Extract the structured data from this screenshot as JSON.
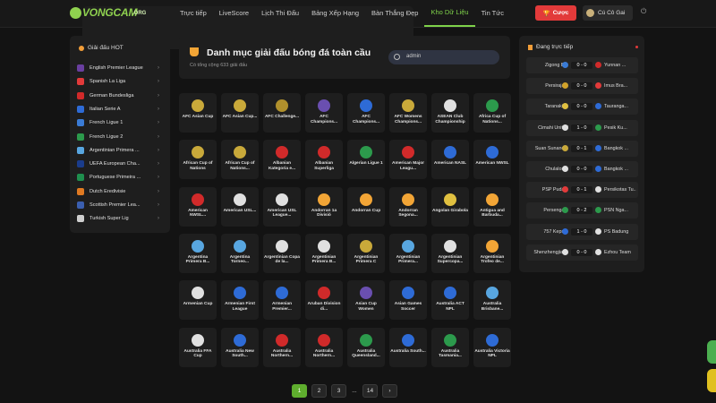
{
  "header": {
    "logo_text": "VONGCAM",
    "logo_tld": ".ORG",
    "nav": [
      "Trực tiếp",
      "LiveScore",
      "Lịch Thi Đấu",
      "Bảng Xếp Hạng",
      "Bàn Thắng Đẹp",
      "Kho Dữ Liệu",
      "Tin Tức"
    ],
    "active_nav": "Kho Dữ Liệu",
    "bet_label": "Cược",
    "user_name": "Cú Cô Gai",
    "accent": "#7fd24a"
  },
  "sidebar": {
    "title": "Giải đấu HOT",
    "leagues": [
      {
        "label": "English Premier League",
        "color": "#6a3fa0"
      },
      {
        "label": "Spanish La Liga",
        "color": "#e23a3a"
      },
      {
        "label": "German Bundesliga",
        "color": "#d12a2a"
      },
      {
        "label": "Italian Serie A",
        "color": "#2e6bd6"
      },
      {
        "label": "French Ligue 1",
        "color": "#3a7bd5"
      },
      {
        "label": "French Ligue 2",
        "color": "#2c9a4c"
      },
      {
        "label": "Argentinian Primera ...",
        "color": "#58a6e0"
      },
      {
        "label": "UEFA European Cha...",
        "color": "#1a3c8c"
      },
      {
        "label": "Portuguese Primeira ...",
        "color": "#1f8f4e"
      },
      {
        "label": "Dutch Eredivisie",
        "color": "#e07a22"
      },
      {
        "label": "Scottish Premier Lea...",
        "color": "#3b5fb0"
      },
      {
        "label": "Turkish Super Lig",
        "color": "#cfcfcf"
      }
    ]
  },
  "main": {
    "title": "Danh mục giải đấu bóng đá toàn cầu",
    "subtitle": "Có tổng cộng 633 giải đấu",
    "search_value": "admin",
    "cards": [
      {
        "name": "AFC Asian Cup",
        "color": "#c9a93a"
      },
      {
        "name": "AFC Asian Cup...",
        "color": "#c9a93a"
      },
      {
        "name": "AFC Challenge...",
        "color": "#b0902c"
      },
      {
        "name": "AFC Champions...",
        "color": "#6a4fb0"
      },
      {
        "name": "AFC Champions...",
        "color": "#2e6bd6"
      },
      {
        "name": "AFC Womens Champions...",
        "color": "#c9a93a"
      },
      {
        "name": "ASEAN Club Championship",
        "color": "#e0e0e0"
      },
      {
        "name": "Africa Cup of Nations...",
        "color": "#2c9a4c"
      },
      {
        "name": "African Cup of Nations",
        "color": "#c9a93a"
      },
      {
        "name": "African Cup of Nations...",
        "color": "#c9a93a"
      },
      {
        "name": "Albanian Kategoria e...",
        "color": "#d12a2a"
      },
      {
        "name": "Albanian Superliga",
        "color": "#d12a2a"
      },
      {
        "name": "Algerian Ligue 1",
        "color": "#2c9a4c"
      },
      {
        "name": "American Major Leagu...",
        "color": "#d12a2a"
      },
      {
        "name": "American NASL",
        "color": "#2e6bd6"
      },
      {
        "name": "American NWSL",
        "color": "#2e6bd6"
      },
      {
        "name": "American NWSL...",
        "color": "#d12a2a"
      },
      {
        "name": "American USL...",
        "color": "#e0e0e0"
      },
      {
        "name": "American USL League...",
        "color": "#e0e0e0"
      },
      {
        "name": "Andorran 1a Divisió",
        "color": "#f2a536"
      },
      {
        "name": "Andorran Cup",
        "color": "#f2a536"
      },
      {
        "name": "Andorran Segona...",
        "color": "#f2a536"
      },
      {
        "name": "Angolan Girabola",
        "color": "#e0c040"
      },
      {
        "name": "Antigua and Barbuda...",
        "color": "#f2a536"
      },
      {
        "name": "Argentina Primera B...",
        "color": "#58a6e0"
      },
      {
        "name": "Argentina Torneo...",
        "color": "#58a6e0"
      },
      {
        "name": "Argentinian Copa de la...",
        "color": "#e0e0e0"
      },
      {
        "name": "Argentinian Primera B...",
        "color": "#e0e0e0"
      },
      {
        "name": "Argentinian Primera C",
        "color": "#c9a93a"
      },
      {
        "name": "Argentinian Primera...",
        "color": "#58a6e0"
      },
      {
        "name": "Argentinian Supercopa...",
        "color": "#e0e0e0"
      },
      {
        "name": "Argentinian Trofeo de...",
        "color": "#f2a536"
      },
      {
        "name": "Armenian Cup",
        "color": "#e0e0e0"
      },
      {
        "name": "Armenian First League",
        "color": "#2e6bd6"
      },
      {
        "name": "Armenian Premier...",
        "color": "#2e6bd6"
      },
      {
        "name": "Aruban Division di...",
        "color": "#d12a2a"
      },
      {
        "name": "Asian Cup Women",
        "color": "#6a4fb0"
      },
      {
        "name": "Asian Games Soccer",
        "color": "#2e6bd6"
      },
      {
        "name": "Australia ACT NPL",
        "color": "#2e6bd6"
      },
      {
        "name": "Australia Brisbane...",
        "color": "#58a6e0"
      },
      {
        "name": "Australia FFA Cup",
        "color": "#e0e0e0"
      },
      {
        "name": "Australia New South...",
        "color": "#2e6bd6"
      },
      {
        "name": "Australia Northern...",
        "color": "#d12a2a"
      },
      {
        "name": "Australia Northern...",
        "color": "#d12a2a"
      },
      {
        "name": "Australia Queensland...",
        "color": "#2c9a4c"
      },
      {
        "name": "Australia South...",
        "color": "#2e6bd6"
      },
      {
        "name": "Australia Tasmania...",
        "color": "#2c9a4c"
      },
      {
        "name": "Australia Victoria NPL",
        "color": "#2e6bd6"
      }
    ]
  },
  "pagination": {
    "pages": [
      "1",
      "2",
      "3"
    ],
    "ellipsis": "...",
    "last": "14",
    "next": "›",
    "current": "1"
  },
  "live": {
    "title": "Đang trực tiếp",
    "matches": [
      {
        "home": "Zigong B...",
        "score": "0 - 0",
        "away": "Yunnan ...",
        "hc": "#3a7bd5",
        "ac": "#d12a2a"
      },
      {
        "home": "Persiraja...",
        "score": "0 - 0",
        "away": "Imus Bra...",
        "hc": "#d1a22a",
        "ac": "#e23a3a"
      },
      {
        "home": "Taranaki ...",
        "score": "0 - 0",
        "away": "Tauranga...",
        "hc": "#e0c040",
        "ac": "#2e6bd6"
      },
      {
        "home": "Cimahi United",
        "score": "1 - 0",
        "away": "Pesik Ku...",
        "hc": "#e0e0e0",
        "ac": "#2c9a4c"
      },
      {
        "home": "Suan Sunand...",
        "score": "0 - 1",
        "away": "Bangkok ...",
        "hc": "#c9a93a",
        "ac": "#2e6bd6"
      },
      {
        "home": "Chulalon...",
        "score": "0 - 0",
        "away": "Bangkok ...",
        "hc": "#e0e0e0",
        "ac": "#2e6bd6"
      },
      {
        "home": "PSP Puda...",
        "score": "0 - 1",
        "away": "Persikotas Tu...",
        "hc": "#e23a3a",
        "ac": "#e0e0e0"
      },
      {
        "home": "Persenga...",
        "score": "0 - 2",
        "away": "PSN Nga...",
        "hc": "#2c9a4c",
        "ac": "#2c9a4c"
      },
      {
        "home": "757 Kepri...",
        "score": "1 - 0",
        "away": "PS Badung",
        "hc": "#2e6bd6",
        "ac": "#e0e0e0"
      },
      {
        "home": "Shenzhengjia ...",
        "score": "0 - 0",
        "away": "Ezhou Team",
        "hc": "#e0e0e0",
        "ac": "#e0e0e0"
      }
    ]
  }
}
